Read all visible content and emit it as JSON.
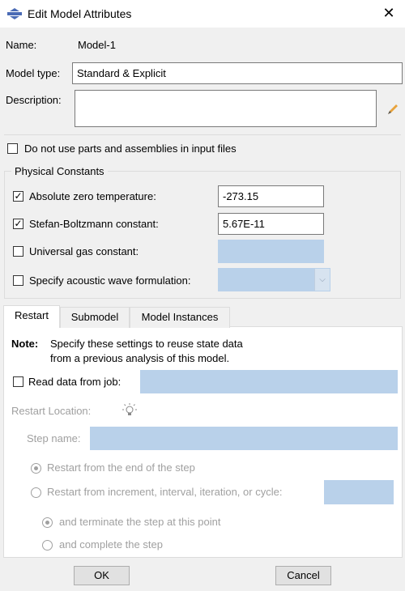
{
  "dialog": {
    "title": "Edit Model Attributes",
    "close_label": "✕"
  },
  "colors": {
    "disabled_field": "#b9d1ea",
    "window_bg": "#f0f0f0",
    "accent": "#4a6bb5"
  },
  "form": {
    "name_label": "Name:",
    "name_value": "Model-1",
    "model_type_label": "Model type:",
    "model_type_value": "Standard & Explicit",
    "description_label": "Description:",
    "description_value": "",
    "no_parts_label": "Do not use parts and assemblies in input files",
    "no_parts_checked": false
  },
  "physical_constants": {
    "group_label": "Physical Constants",
    "items": [
      {
        "label": "Absolute zero temperature:",
        "checked": true,
        "value": "-273.15"
      },
      {
        "label": "Stefan-Boltzmann constant:",
        "checked": true,
        "value": "5.67E-11"
      },
      {
        "label": "Universal gas constant:",
        "checked": false,
        "value": ""
      },
      {
        "label": "Specify acoustic wave formulation:",
        "checked": false,
        "value": ""
      }
    ]
  },
  "tabs": [
    {
      "label": "Restart",
      "active": true
    },
    {
      "label": "Submodel",
      "active": false
    },
    {
      "label": "Model Instances",
      "active": false
    }
  ],
  "restart": {
    "note_label": "Note:",
    "note_text_1": "Specify these settings to reuse state data",
    "note_text_2": "from a previous analysis of this model.",
    "read_data_label": "Read data from job:",
    "read_data_checked": false,
    "restart_location_label": "Restart Location:",
    "step_name_label": "Step name:",
    "radio_end_step": "Restart from the end of the step",
    "radio_increment": "Restart from increment, interval, iteration, or cycle:",
    "radio_terminate": "and terminate the step at this point",
    "radio_complete": "and complete the step"
  },
  "buttons": {
    "ok_label": "OK",
    "cancel_label": "Cancel"
  }
}
